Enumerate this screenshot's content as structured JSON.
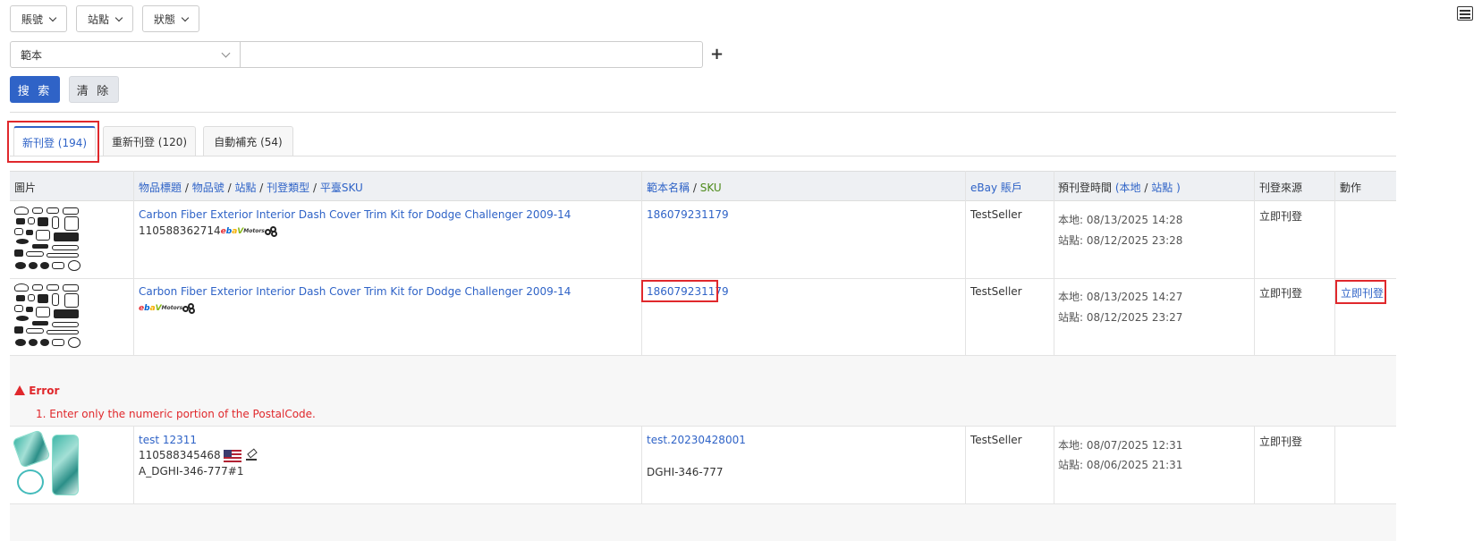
{
  "filters": {
    "account_label": "賬號",
    "site_label": "站點",
    "status_label": "狀態"
  },
  "search": {
    "field_selected": "範本",
    "query_value": "",
    "add_condition": "+",
    "search_button": "搜 索",
    "clear_button": "清 除"
  },
  "tabs": [
    {
      "label": "新刊登 (194)"
    },
    {
      "label": "重新刊登 (120)"
    },
    {
      "label": "自動補充 (54)"
    }
  ],
  "table": {
    "headers": {
      "image": "圖片",
      "item_title": "物品標題",
      "item_no": "物品號",
      "site": "站點",
      "listing_type": "刊登類型",
      "platform_sku": "平臺SKU",
      "template_name": "範本名稱",
      "sku": "SKU",
      "ebay_account": "eBay 賬戶",
      "scheduled_time": "預刊登時間",
      "local": "本地",
      "site_time": "站點",
      "source": "刊登來源",
      "action": "動作",
      "slash": "/",
      "paren_open": "(",
      "paren_close": ")"
    },
    "rows": [
      {
        "title": "Carbon Fiber Exterior Interior Dash Cover Trim Kit for Dodge Challenger 2009-14",
        "item_no": "110588362714",
        "template": "186079231179",
        "sku": "",
        "account": "TestSeller",
        "local_time": "本地:   08/13/2025 14:28",
        "site_time": "站點:   08/12/2025 23:28",
        "source": "立即刊登",
        "action": ""
      },
      {
        "title": "Carbon Fiber Exterior Interior Dash Cover Trim Kit for Dodge Challenger 2009-14",
        "item_no": "",
        "template": "186079231179",
        "sku": "",
        "account": "TestSeller",
        "local_time": "本地:   08/13/2025 14:27",
        "site_time": "站點:   08/12/2025 23:27",
        "source": "立即刊登",
        "action": "立即刊登"
      },
      {
        "title": "test 12311",
        "item_no": "110588345468",
        "platform_sku": "A_DGHI-346-777#1",
        "template": "test.20230428001",
        "sku": "DGHI-346-777",
        "account": "TestSeller",
        "local_time": "本地:   08/07/2025 12:31",
        "site_time": "站點:   08/06/2025 21:31",
        "source": "立即刊登",
        "action": ""
      }
    ],
    "error": {
      "heading": "Error",
      "message": "1. Enter only the numeric portion of the PostalCode."
    }
  },
  "ebay_logo": {
    "e": "e",
    "b": "b",
    "a": "a",
    "y": "V",
    "motors": "Motors"
  }
}
